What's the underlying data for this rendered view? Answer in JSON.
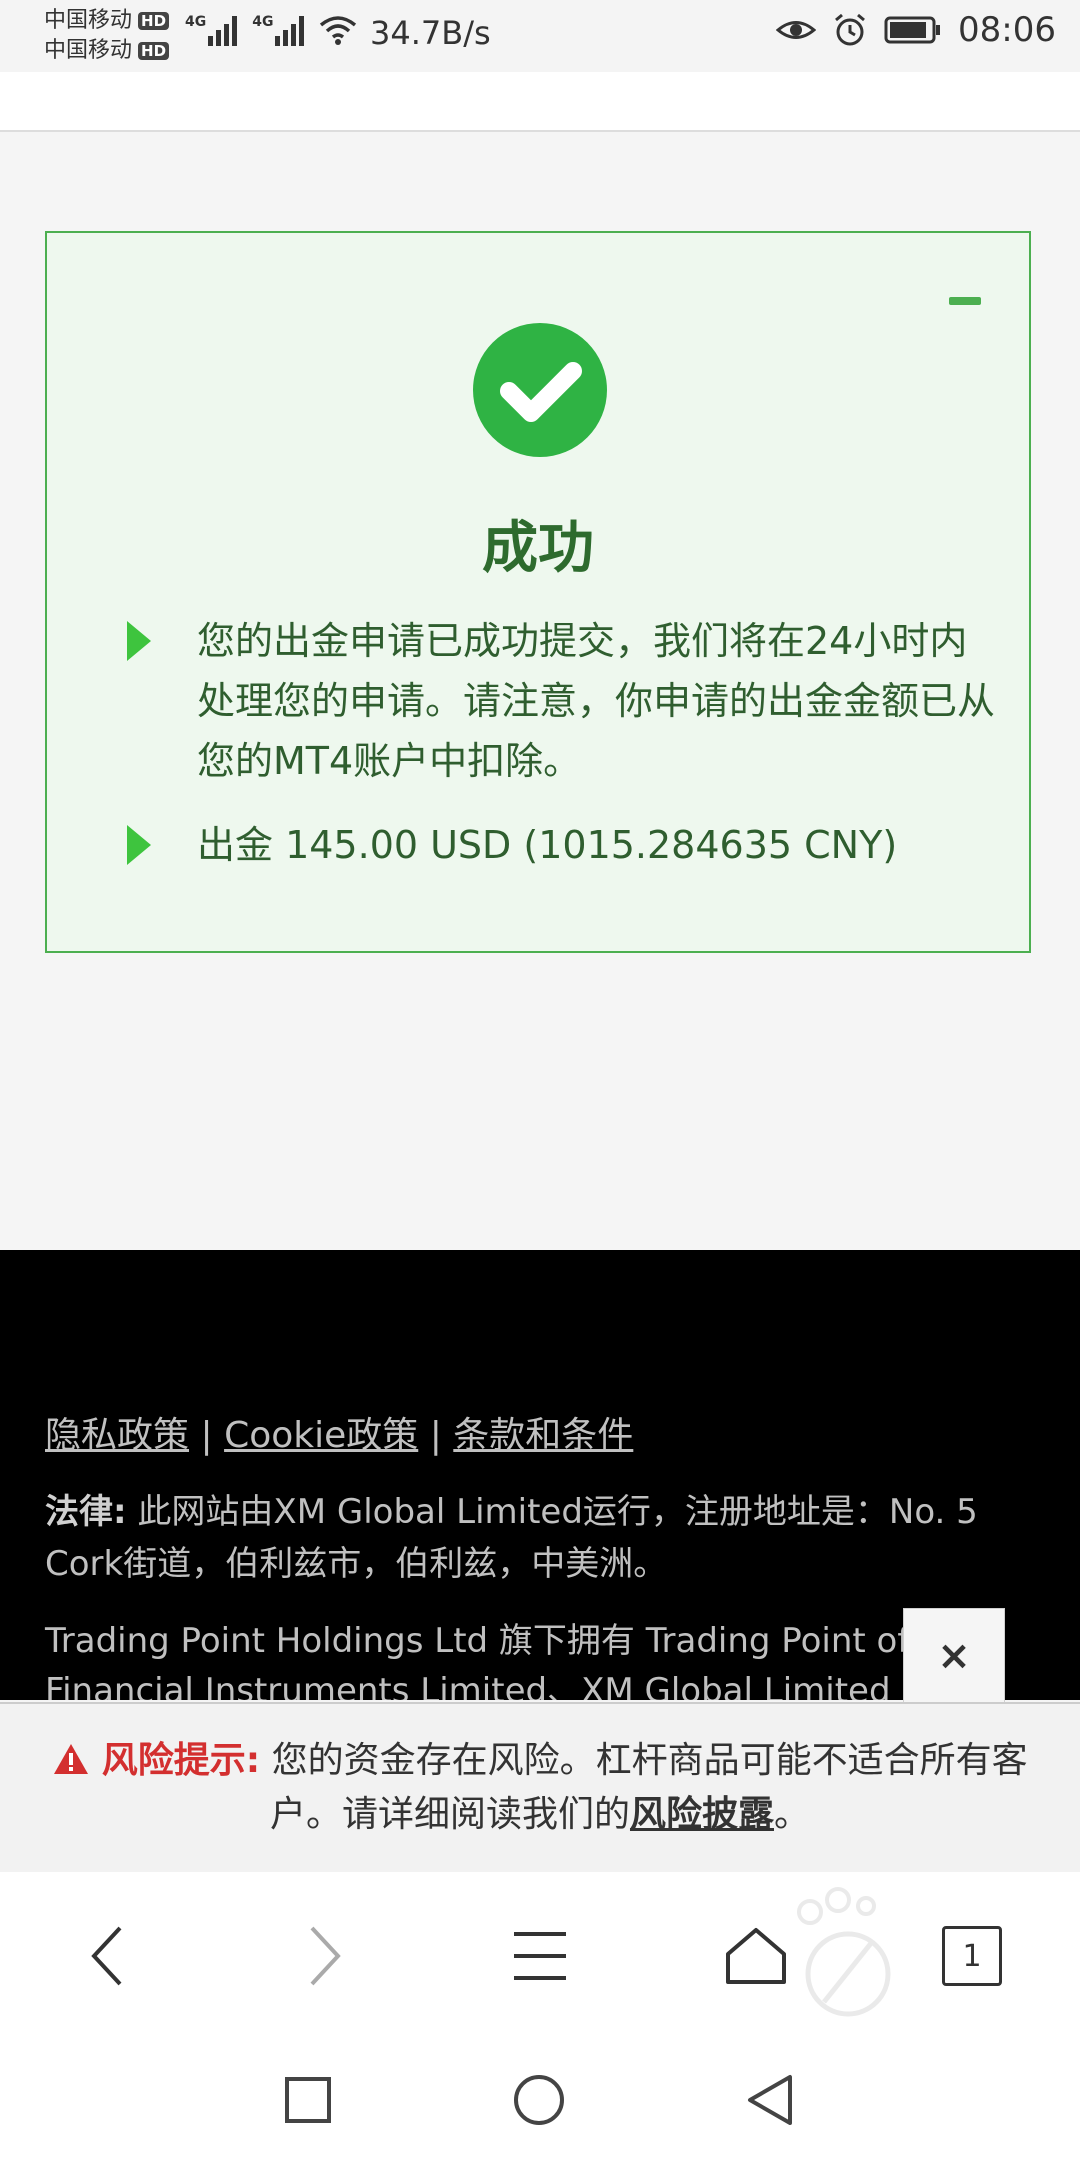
{
  "status_bar": {
    "carrier_1": "中国移动",
    "carrier_2": "中国移动",
    "hd_badge": "HD",
    "network_type": "4G",
    "net_speed": "34.7B/s",
    "time": "08:06"
  },
  "card": {
    "title": "成功",
    "message": "您的出金申请已成功提交，我们将在24小时内处理您的申请。请注意，你申请的出金金额已从您的MT4账户中扣除。",
    "amount_line": "出金 145.00 USD (1015.284635 CNY)"
  },
  "footer": {
    "link_privacy": "隐私政策",
    "link_cookie": "Cookie政策",
    "link_terms": "条款和条件",
    "separator": "|",
    "legal_label": "法律:",
    "legal_text": "此网站由XM Global Limited运行，注册地址是：No. 5 Cork街道，伯利兹市，伯利兹，中美洲。",
    "trading_text": "Trading Point Holdings Ltd 旗下拥有 Trading Point of Financial Instruments Limited、XM Global Limited"
  },
  "close_popup": {
    "label": "×"
  },
  "risk": {
    "label": "风险提示:",
    "text": "您的资金存在风险。杠杆商品可能不适合所有客户。请详细阅读我们的",
    "link": "风险披露",
    "end": "。"
  },
  "browser": {
    "tab_count": "1"
  },
  "colors": {
    "success_green": "#2fb344",
    "card_border": "#4caf50",
    "card_bg": "#eef8ee",
    "risk_red": "#d32f2f",
    "footer_bg": "#000000"
  }
}
